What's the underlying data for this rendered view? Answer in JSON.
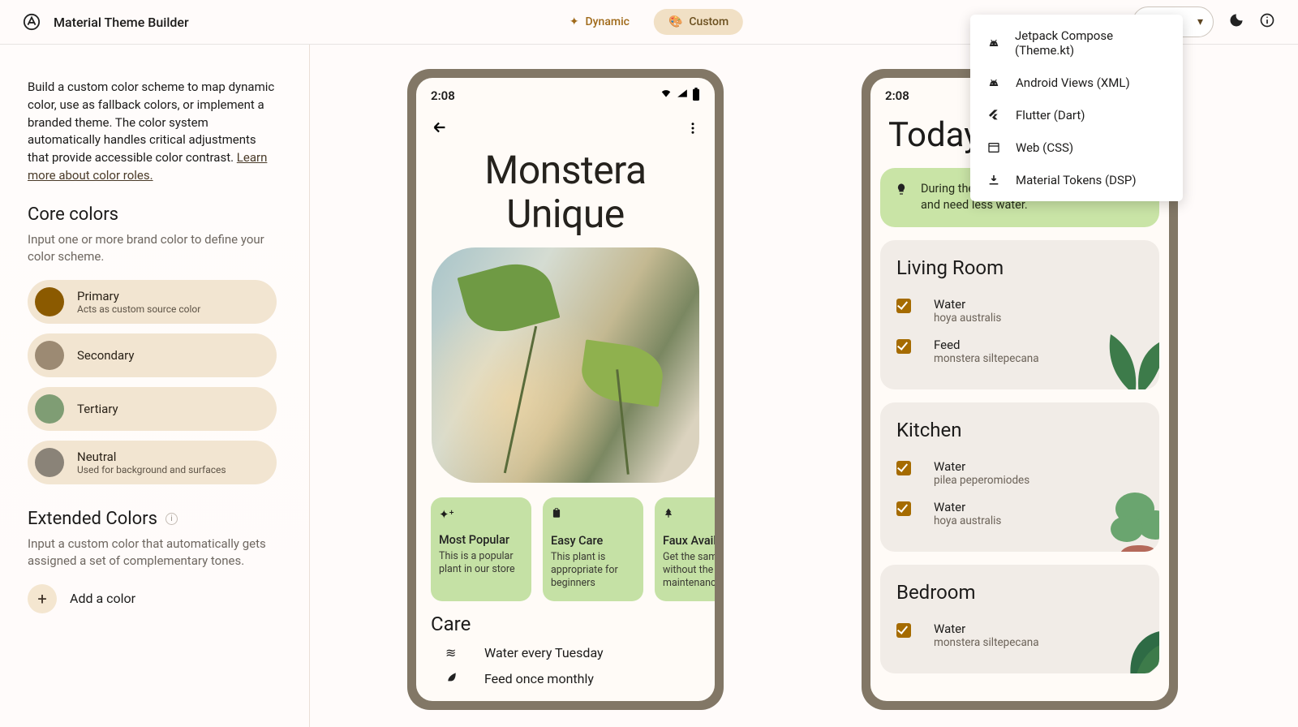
{
  "header": {
    "app_title": "Material Theme Builder",
    "tabs": {
      "dynamic": "Dynamic",
      "custom": "Custom"
    },
    "export_items": [
      "Jetpack Compose (Theme.kt)",
      "Android Views (XML)",
      "Flutter (Dart)",
      "Web (CSS)",
      "Material Tokens (DSP)"
    ]
  },
  "sidebar": {
    "intro_text": "Build a custom color scheme to map dynamic color, use as fallback colors, or implement a branded theme. The color system automatically handles critical adjustments that provide accessible color contrast. ",
    "intro_link": "Learn more about color roles.",
    "core_title": "Core colors",
    "core_sub": "Input one or more brand color to define your color scheme.",
    "colors": [
      {
        "label": "Primary",
        "sub": "Acts as custom source color",
        "hex": "#8b5a00"
      },
      {
        "label": "Secondary",
        "sub": "",
        "hex": "#9c8a73"
      },
      {
        "label": "Tertiary",
        "sub": "",
        "hex": "#7f9d74"
      },
      {
        "label": "Neutral",
        "sub": "Used for background and surfaces",
        "hex": "#8a8378"
      }
    ],
    "ext_title": "Extended Colors",
    "ext_sub": "Input a custom color that automatically gets assigned a set of complementary tones.",
    "add_color": "Add a color"
  },
  "preview": {
    "status_time": "2:08",
    "screen1": {
      "hero_title_l1": "Monstera",
      "hero_title_l2": "Unique",
      "cards": [
        {
          "icon": "✦",
          "title": "Most Popular",
          "sub": "This is a popular plant in our store"
        },
        {
          "icon": "clipboard",
          "title": "Easy Care",
          "sub": "This plant is appropriate for beginners"
        },
        {
          "icon": "tree",
          "title": "Faux Available",
          "sub": "Get the same look without the maintenance"
        }
      ],
      "care_title": "Care",
      "care": [
        {
          "label": "Water every Tuesday"
        },
        {
          "label": "Feed once monthly"
        }
      ]
    },
    "screen2": {
      "today_title": "Today",
      "tip": "During the winter your plants slow down and need less water.",
      "rooms": [
        {
          "title": "Living Room",
          "tasks": [
            {
              "action": "Water",
              "plant": "hoya australis"
            },
            {
              "action": "Feed",
              "plant": "monstera siltepecana"
            }
          ]
        },
        {
          "title": "Kitchen",
          "tasks": [
            {
              "action": "Water",
              "plant": "pilea peperomiodes"
            },
            {
              "action": "Water",
              "plant": "hoya australis"
            }
          ]
        },
        {
          "title": "Bedroom",
          "tasks": [
            {
              "action": "Water",
              "plant": "monstera siltepecana"
            }
          ]
        }
      ]
    }
  }
}
